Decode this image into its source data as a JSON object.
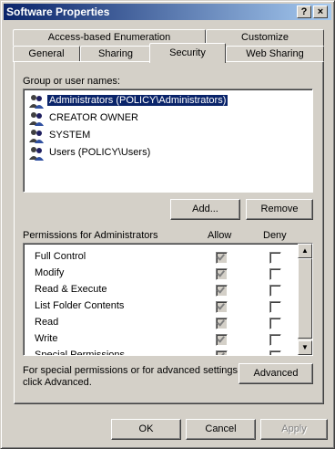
{
  "window": {
    "title": "Software Properties",
    "help_label": "?",
    "close_label": "×"
  },
  "tabs": {
    "row1": [
      "Access-based Enumeration",
      "Customize"
    ],
    "row2": [
      "General",
      "Sharing",
      "Security",
      "Web Sharing"
    ],
    "active": "Security"
  },
  "group": {
    "label": "Group or user names:",
    "users": [
      {
        "name": "Administrators (POLICY\\Administrators)",
        "selected": true
      },
      {
        "name": "CREATOR OWNER",
        "selected": false
      },
      {
        "name": "SYSTEM",
        "selected": false
      },
      {
        "name": "Users (POLICY\\Users)",
        "selected": false
      }
    ],
    "add_label": "Add...",
    "remove_label": "Remove"
  },
  "permissions": {
    "label": "Permissions for Administrators",
    "allow_header": "Allow",
    "deny_header": "Deny",
    "rows": [
      {
        "name": "Full Control",
        "allow": true,
        "deny": false
      },
      {
        "name": "Modify",
        "allow": true,
        "deny": false
      },
      {
        "name": "Read & Execute",
        "allow": true,
        "deny": false
      },
      {
        "name": "List Folder Contents",
        "allow": true,
        "deny": false
      },
      {
        "name": "Read",
        "allow": true,
        "deny": false
      },
      {
        "name": "Write",
        "allow": true,
        "deny": false
      },
      {
        "name": "Special Permissions",
        "allow": true,
        "deny": false
      }
    ],
    "scroll_up_icon": "▲",
    "scroll_down_icon": "▼"
  },
  "advanced": {
    "text_line1": "For special permissions or for advanced settings,",
    "text_line2": "click Advanced.",
    "button_label": "Advanced"
  },
  "footer": {
    "ok_label": "OK",
    "cancel_label": "Cancel",
    "apply_label": "Apply"
  },
  "colors": {
    "face": "#d4d0c8",
    "title_start": "#0a246a",
    "title_end": "#a6caf0",
    "selection": "#0a246a"
  },
  "icons": {
    "user": "user-group-icon",
    "check": "check-icon"
  }
}
